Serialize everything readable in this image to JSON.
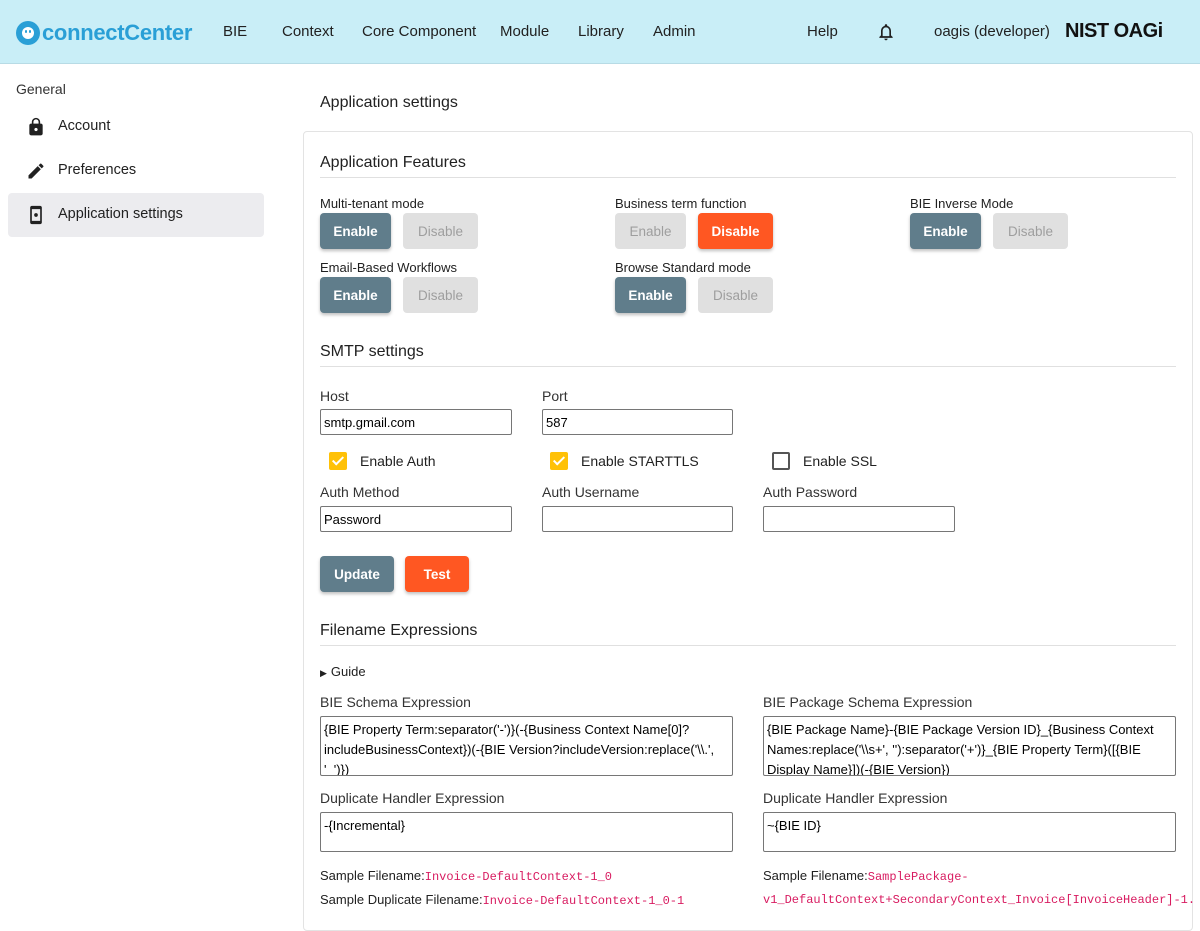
{
  "header": {
    "logo_text": "connectCenter",
    "nav": [
      "BIE",
      "Context",
      "Core Component",
      "Module",
      "Library",
      "Admin"
    ],
    "help": "Help",
    "user": "oagis (developer)",
    "org_logo": "NIST OAGi",
    "icons": {
      "logo": "connect-logo-icon",
      "bell": "notification-bell-icon"
    }
  },
  "sidebar": {
    "heading": "General",
    "items": [
      {
        "label": "Account",
        "icon": "lock-icon"
      },
      {
        "label": "Preferences",
        "icon": "pencil-icon"
      },
      {
        "label": "Application settings",
        "icon": "app-settings-icon",
        "active": true
      }
    ]
  },
  "main": {
    "title": "Application settings",
    "features": {
      "title": "Application Features",
      "items": [
        {
          "label": "Multi-tenant mode",
          "enable": "Enable",
          "disable": "Disable",
          "state": "enabled"
        },
        {
          "label": "Business term function",
          "enable": "Enable",
          "disable": "Disable",
          "state": "disabled"
        },
        {
          "label": "BIE Inverse Mode",
          "enable": "Enable",
          "disable": "Disable",
          "state": "enabled"
        },
        {
          "label": "Email-Based Workflows",
          "enable": "Enable",
          "disable": "Disable",
          "state": "enabled"
        },
        {
          "label": "Browse Standard mode",
          "enable": "Enable",
          "disable": "Disable",
          "state": "enabled"
        }
      ]
    },
    "smtp": {
      "title": "SMTP settings",
      "host_label": "Host",
      "host_value": "smtp.gmail.com",
      "port_label": "Port",
      "port_value": "587",
      "enable_auth_label": "Enable Auth",
      "enable_auth": true,
      "enable_starttls_label": "Enable STARTTLS",
      "enable_starttls": true,
      "enable_ssl_label": "Enable SSL",
      "enable_ssl": false,
      "auth_method_label": "Auth Method",
      "auth_method_value": "Password",
      "auth_username_label": "Auth Username",
      "auth_username_value": "",
      "auth_password_label": "Auth Password",
      "auth_password_value": "",
      "update_label": "Update",
      "test_label": "Test"
    },
    "filename": {
      "title": "Filename Expressions",
      "guide": "Guide",
      "bie_schema_label": "BIE Schema Expression",
      "bie_schema_value": "{BIE Property Term:separator('-')}(-{Business Context Name[0]?includeBusinessContext})(-{BIE Version?includeVersion:replace('\\\\.', '_')})",
      "bie_package_label": "BIE Package Schema Expression",
      "bie_package_value": "{BIE Package Name}-{BIE Package Version ID}_{Business Context Names:replace('\\\\s+', ''):separator('+')}_{BIE Property Term}([{BIE Display Name}])(-{BIE Version})",
      "dup_label_left": "Duplicate Handler Expression",
      "dup_value_left": "-{Incremental}",
      "dup_label_right": "Duplicate Handler Expression",
      "dup_value_right": "~{BIE ID}",
      "sample_filename_label": "Sample Filename:",
      "sample_filename_left": "Invoice-DefaultContext-1_0",
      "sample_dup_label": "Sample Duplicate Filename:",
      "sample_dup_left": "Invoice-DefaultContext-1_0-1",
      "sample_filename_right_line1": "SamplePackage-",
      "sample_filename_right_line2": "v1_DefaultContext+SecondaryContext_Invoice[InvoiceHeader]-1."
    }
  },
  "colors": {
    "accent_slate": "#607d8b",
    "accent_orange": "#ff5722",
    "checkbox": "#ffc107",
    "topbar": "#c9eef7"
  }
}
